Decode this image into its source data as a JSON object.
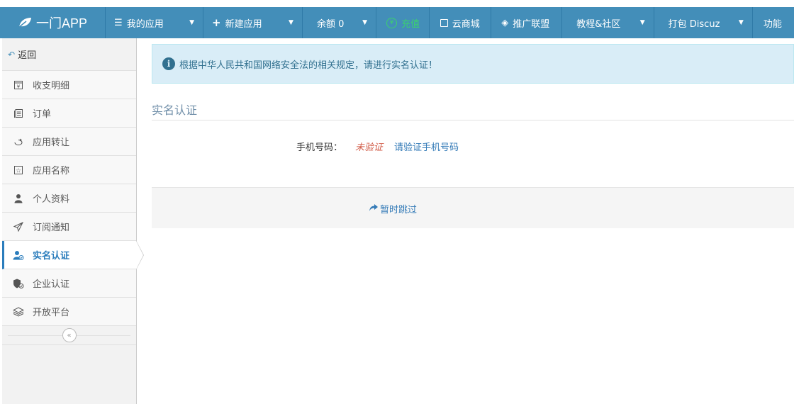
{
  "brand": {
    "name": "一门APP",
    "logo_icon": "leaf-icon"
  },
  "nav": [
    {
      "key": "my-apps",
      "label": "我的应用",
      "icon": "list-icon",
      "dropdown": true
    },
    {
      "key": "new-app",
      "label": "新建应用",
      "icon": "plus-icon",
      "dropdown": true
    },
    {
      "key": "balance",
      "label": "余额 0",
      "icon": "",
      "dropdown": true
    },
    {
      "key": "recharge",
      "label": "充值",
      "icon": "yen-icon",
      "dropdown": false
    },
    {
      "key": "cloud-store",
      "label": "云商城",
      "icon": "store-icon",
      "dropdown": false
    },
    {
      "key": "affiliate",
      "label": "推广联盟",
      "icon": "diamond-icon",
      "dropdown": false
    },
    {
      "key": "tutorial",
      "label": "教程&社区",
      "icon": "",
      "dropdown": true
    },
    {
      "key": "pack-discuz",
      "label": "打包 Discuz",
      "icon": "",
      "dropdown": true
    },
    {
      "key": "features",
      "label": "功能",
      "icon": "",
      "dropdown": false
    }
  ],
  "sidebar": {
    "back_label": "返回",
    "items": [
      {
        "label": "收支明细",
        "icon": "receipt-icon",
        "active": false
      },
      {
        "label": "订单",
        "icon": "document-icon",
        "active": false
      },
      {
        "label": "应用转让",
        "icon": "transfer-icon",
        "active": false
      },
      {
        "label": "应用名称",
        "icon": "star-icon",
        "active": false
      },
      {
        "label": "个人资料",
        "icon": "user-icon",
        "active": false
      },
      {
        "label": "订阅通知",
        "icon": "paper-plane-icon",
        "active": false
      },
      {
        "label": "实名认证",
        "icon": "user-verified-icon",
        "active": true
      },
      {
        "label": "企业认证",
        "icon": "company-verified-icon",
        "active": false
      },
      {
        "label": "开放平台",
        "icon": "layers-icon",
        "active": false
      }
    ]
  },
  "main": {
    "alert_text": "根据中华人民共和国网络安全法的相关规定，请进行实名认证！",
    "title": "实名认证",
    "phone": {
      "label": "手机号码：",
      "status": "未验证",
      "verify_link": "请验证手机号码"
    },
    "skip_label": "暂时跳过"
  },
  "colors": {
    "navbar": "#438eb9",
    "accent": "#2b7dbc",
    "recharge_green": "#3bd16f",
    "alert_bg": "#d9edf7",
    "unverified_red": "#d15b47"
  }
}
